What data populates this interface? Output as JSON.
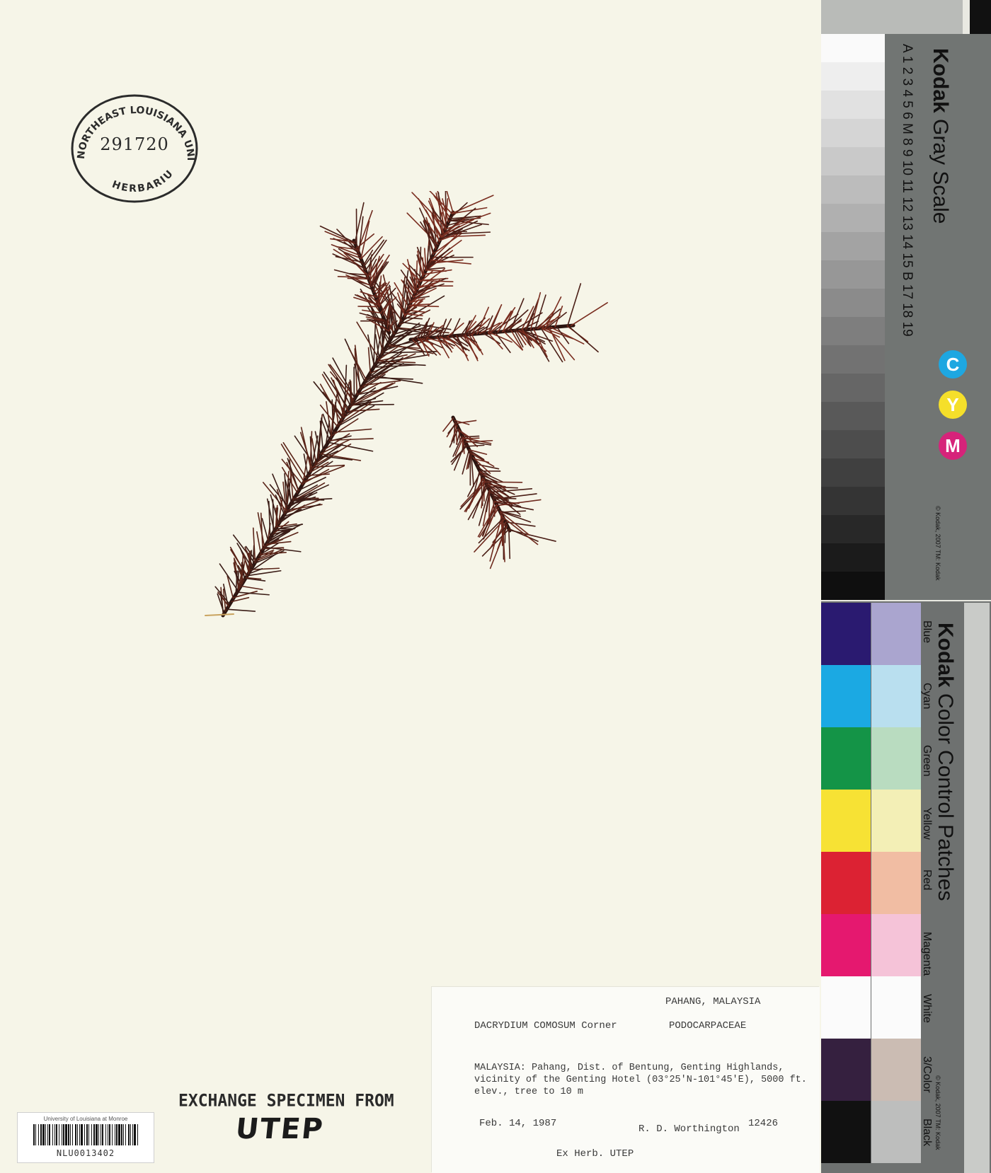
{
  "stamp": {
    "institution": "NORTHEAST LOUISIANA UNIVERSITY",
    "number": "291720",
    "footer": "HERBARIUM"
  },
  "label": {
    "region": "PAHANG, MALAYSIA",
    "taxon": "DACRYDIUM COMOSUM Corner",
    "family": "PODOCARPACEAE",
    "locality": "MALAYSIA: Pahang, Dist. of Bentung, Genting Highlands, vicinity of the Genting Hotel (03°25'N-101°45'E), 5000 ft. elev., tree to 10 m",
    "date": "Feb. 14, 1987",
    "collector": "R. D. Worthington",
    "number": "12426",
    "ex_herb": "Ex Herb. UTEP"
  },
  "exchange": {
    "line1": "EXCHANGE SPECIMEN FROM",
    "line2": "UTEP"
  },
  "barcode": {
    "institution": "University of Louisiana at Monroe",
    "id": "NLU0013402"
  },
  "gray_scale": {
    "brand": "Kodak",
    "title": "Gray Scale",
    "letters": "A 1 2 3 4 5 6 M 8 9 10 11 12 13 14 15 B 17 18 19",
    "cym": [
      "C",
      "Y",
      "M"
    ],
    "copyright": "© Kodak, 2007 TM: Kodak",
    "colors": {
      "cyan": "#1ea7e1",
      "yellow": "#f5df2a",
      "magenta": "#d6237a"
    }
  },
  "color_card": {
    "brand": "Kodak",
    "title": "Color Control Patches",
    "labels": [
      "Blue",
      "Cyan",
      "Green",
      "Yellow",
      "Red",
      "Magenta",
      "White",
      "3/Color",
      "Black"
    ],
    "copyright": "© Kodak, 2007 TM: Kodak",
    "patches_dark": [
      "#2a1a70",
      "#1ba9e3",
      "#149447",
      "#f7e234",
      "#dc2233",
      "#e5186f",
      "#fbfbfb",
      "#35203f",
      "#111111"
    ],
    "patches_light": [
      "#aaa5cf",
      "#b9dfef",
      "#b9dcc0",
      "#f3efb6",
      "#f1bda3",
      "#f5c3d8",
      "#fbfbfb",
      "#cbbcb3",
      "#bdbebd"
    ]
  }
}
